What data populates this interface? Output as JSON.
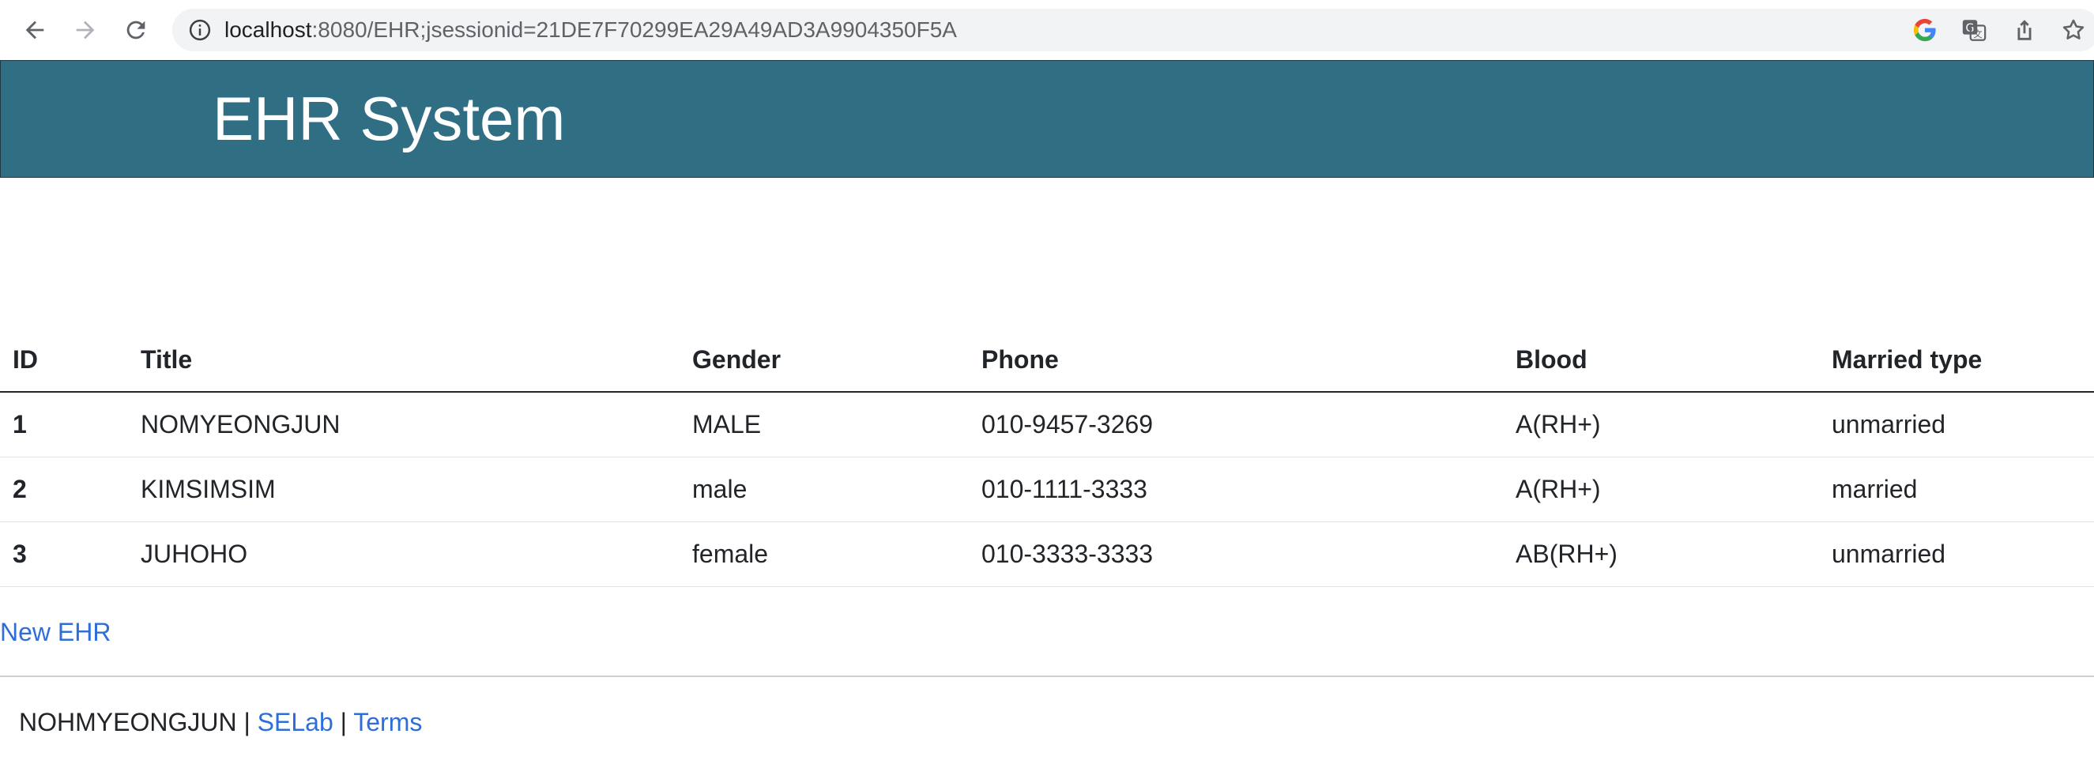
{
  "browser": {
    "url_host": "localhost",
    "url_rest": ":8080/EHR;jsessionid=21DE7F70299EA29A49AD3A9904350F5A",
    "icons": [
      "back-arrow-icon",
      "forward-arrow-icon",
      "reload-icon",
      "info-icon",
      "google-icon",
      "translate-icon",
      "share-icon",
      "bookmark-star-icon"
    ]
  },
  "header": {
    "title": "EHR System",
    "background_color": "#2f6e83"
  },
  "table": {
    "columns": [
      "ID",
      "Title",
      "Gender",
      "Phone",
      "Blood",
      "Married type"
    ],
    "rows": [
      {
        "id": "1",
        "title": "NOMYEONGJUN",
        "gender": "MALE",
        "phone": "010-9457-3269",
        "blood": "A(RH+)",
        "married": "unmarried"
      },
      {
        "id": "2",
        "title": "KIMSIMSIM",
        "gender": "male",
        "phone": "010-1111-3333",
        "blood": "A(RH+)",
        "married": "married"
      },
      {
        "id": "3",
        "title": "JUHOHO",
        "gender": "female",
        "phone": "010-3333-3333",
        "blood": "AB(RH+)",
        "married": "unmarried"
      }
    ]
  },
  "actions": {
    "new_ehr_label": "New EHR"
  },
  "footer": {
    "author": "NOHMYEONGJUN",
    "separator": "|",
    "selab_label": "SELab",
    "terms_label": "Terms",
    "link_color": "#2f6ed8"
  }
}
